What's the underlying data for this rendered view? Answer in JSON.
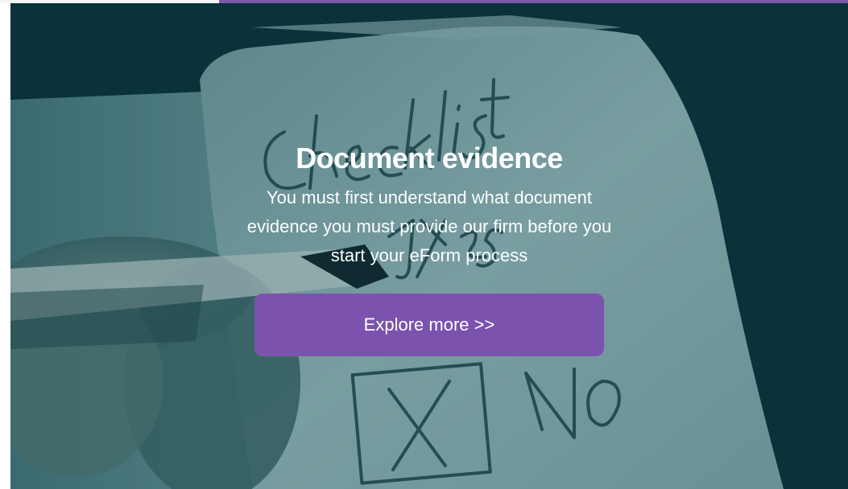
{
  "hero": {
    "background_image": "checklist-notebook-photo",
    "title": "Document evidence",
    "subtitle": "You must first understand what document evidence you must provide our firm before you start your eForm process",
    "button_label": "Explore more >>"
  },
  "colors": {
    "accent": "#7a59a8",
    "button": "#7b52ae",
    "overlay": "#063740",
    "text": "#ffffff"
  }
}
